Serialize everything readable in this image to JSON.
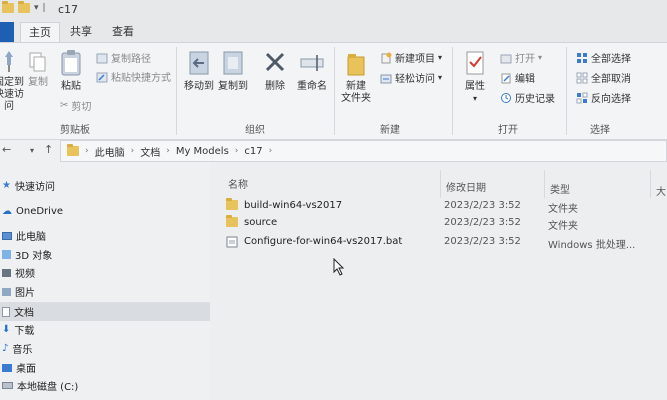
{
  "window": {
    "title": "c17"
  },
  "tabs": {
    "file": "",
    "home": "主页",
    "share": "共享",
    "view": "查看"
  },
  "ribbon": {
    "clipboard": {
      "pin": "固定到\n快速访问",
      "copy": "复制",
      "paste": "粘贴",
      "cut": "剪切",
      "copy_path": "复制路径",
      "paste_shortcut": "粘贴快捷方式",
      "label": "剪贴板"
    },
    "organize": {
      "move_to": "移动到",
      "copy_to": "复制到",
      "delete": "删除",
      "rename": "重命名",
      "label": "组织"
    },
    "new": {
      "new_folder": "新建\n文件夹",
      "new_item": "新建项目",
      "easy_access": "轻松访问",
      "label": "新建"
    },
    "open": {
      "properties": "属性",
      "open": "打开",
      "edit": "编辑",
      "history": "历史记录",
      "label": "打开"
    },
    "select": {
      "select_all": "全部选择",
      "select_none": "全部取消",
      "invert": "反向选择",
      "label": "选择"
    }
  },
  "address": {
    "crumbs": [
      "此电脑",
      "文档",
      "My Models",
      "c17"
    ]
  },
  "nav": {
    "items": [
      {
        "label": "快速访问",
        "icon": "star-icon"
      },
      {
        "label": "OneDrive",
        "icon": "cloud-icon"
      },
      {
        "label": "此电脑",
        "icon": "computer-icon"
      },
      {
        "label": "3D 对象",
        "icon": "cube-icon"
      },
      {
        "label": "视频",
        "icon": "video-icon"
      },
      {
        "label": "图片",
        "icon": "picture-icon"
      },
      {
        "label": "文档",
        "icon": "document-icon"
      },
      {
        "label": "下载",
        "icon": "download-icon"
      },
      {
        "label": "音乐",
        "icon": "music-icon"
      },
      {
        "label": "桌面",
        "icon": "desktop-icon"
      },
      {
        "label": "本地磁盘 (C:)",
        "icon": "drive-icon"
      }
    ]
  },
  "columns": {
    "name": "名称",
    "date": "修改日期",
    "type": "类型",
    "size": "大"
  },
  "files": [
    {
      "name": "build-win64-vs2017",
      "date": "2023/2/23 3:52",
      "type": "文件夹",
      "icon": "folder-icon"
    },
    {
      "name": "source",
      "date": "2023/2/23 3:52",
      "type": "文件夹",
      "icon": "folder-icon"
    },
    {
      "name": "Configure-for-win64-vs2017.bat",
      "date": "2023/2/23 3:52",
      "type": "Windows 批处理...",
      "icon": "batch-file-icon"
    }
  ],
  "colors": {
    "accent": "#1e5fb4",
    "folder": "#e8c25a"
  }
}
